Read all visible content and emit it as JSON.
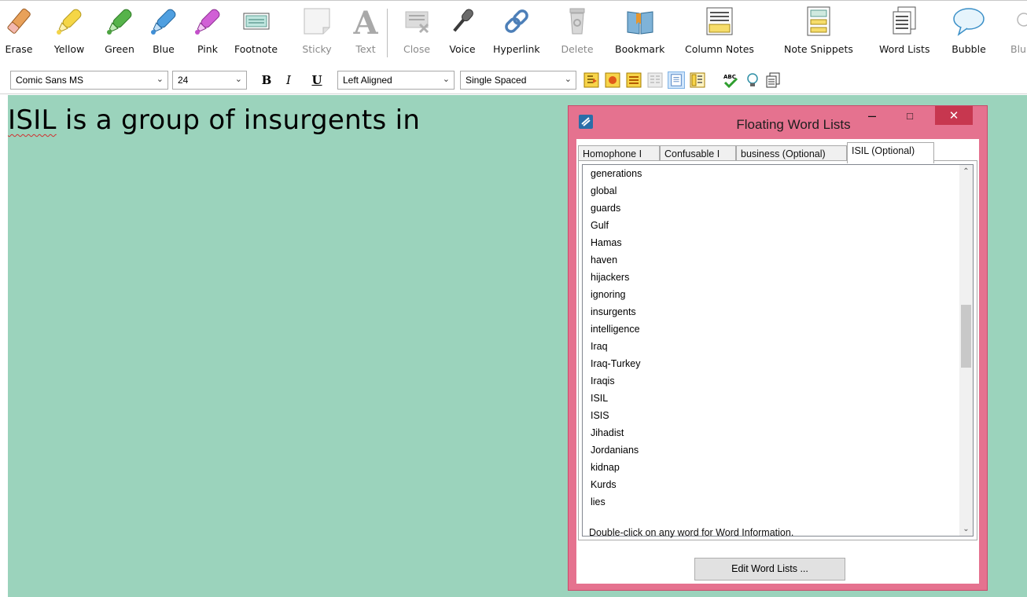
{
  "toolbar": {
    "tools": [
      {
        "label": "Erase",
        "icon": "eraser-icon"
      },
      {
        "label": "Yellow",
        "icon": "yellow-highlighter-icon"
      },
      {
        "label": "Green",
        "icon": "green-highlighter-icon"
      },
      {
        "label": "Blue",
        "icon": "blue-highlighter-icon"
      },
      {
        "label": "Pink",
        "icon": "pink-highlighter-icon"
      },
      {
        "label": "Footnote",
        "icon": "footnote-icon"
      },
      {
        "label": "Sticky",
        "icon": "sticky-note-icon"
      },
      {
        "label": "Text",
        "icon": "text-icon"
      },
      {
        "label": "Close",
        "icon": "close-note-icon"
      },
      {
        "label": "Voice",
        "icon": "microphone-icon"
      },
      {
        "label": "Hyperlink",
        "icon": "hyperlink-icon"
      },
      {
        "label": "Delete",
        "icon": "trash-icon"
      },
      {
        "label": "Bookmark",
        "icon": "bookmark-icon"
      },
      {
        "label": "Column Notes",
        "icon": "column-notes-icon"
      },
      {
        "label": "Note Snippets",
        "icon": "note-snippets-icon"
      },
      {
        "label": "Word Lists",
        "icon": "word-lists-icon"
      },
      {
        "label": "Bubble",
        "icon": "speech-bubble-icon"
      },
      {
        "label": "Blu",
        "icon": "partial-icon"
      }
    ]
  },
  "format": {
    "font": "Comic Sans MS",
    "size": "24",
    "bold": "B",
    "italic": "I",
    "underline": "U",
    "alignment": "Left Aligned",
    "spacing": "Single Spaced"
  },
  "document": {
    "word1": "ISIL",
    "rest": " is a group of insurgents in",
    "background": "#9bd3bc"
  },
  "floating": {
    "title": "Floating Word Lists",
    "minimize": "–",
    "maximize": "□",
    "close": "✕",
    "tabs": [
      "Homophone I",
      "Confusable I",
      "business  (Optional)",
      "ISIL  (Optional)"
    ],
    "active_tab": "ISIL  (Optional)",
    "words": [
      "generations",
      "global",
      "guards",
      "Gulf",
      "Hamas",
      "haven",
      "hijackers",
      "ignoring",
      "insurgents",
      "intelligence",
      "Iraq",
      "Iraq-Turkey",
      "Iraqis",
      "ISIL",
      "ISIS",
      "Jihadist",
      "Jordanians",
      "kidnap",
      "Kurds",
      "lies"
    ],
    "hint": "Double-click on any word for Word Information.",
    "edit_button": "Edit Word Lists ...",
    "frame_color": "#e5728f"
  }
}
